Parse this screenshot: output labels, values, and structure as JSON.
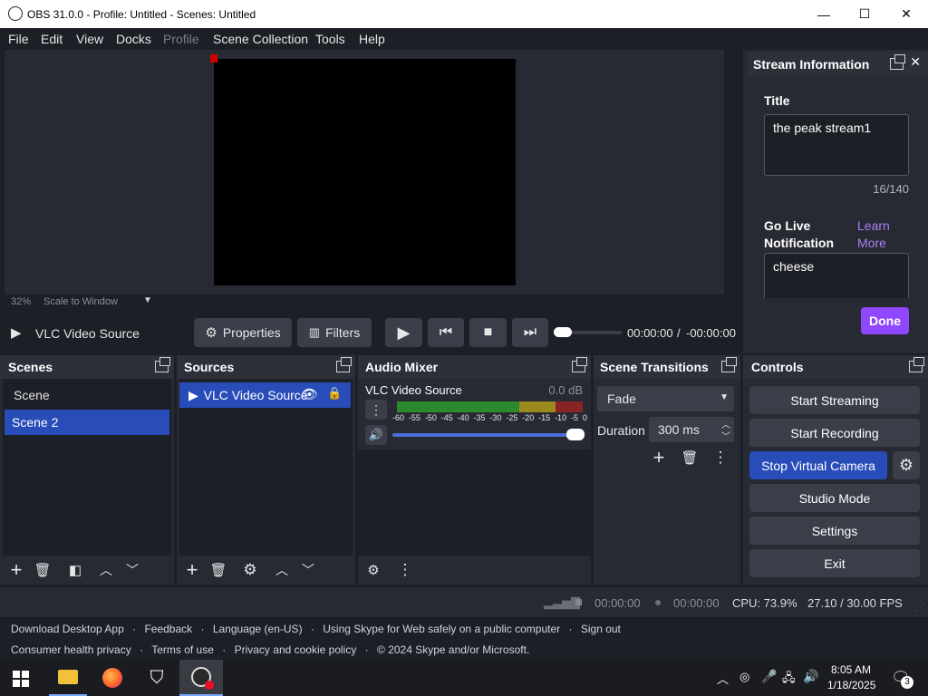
{
  "window": {
    "title": "OBS 31.0.0 - Profile: Untitled - Scenes: Untitled",
    "minimize": "—",
    "maximize": "☐",
    "close": "✕"
  },
  "menu": [
    "File",
    "Edit",
    "View",
    "Docks",
    "Profile",
    "Scene Collection",
    "Tools",
    "Help"
  ],
  "preview": {
    "zoom": "32%",
    "scale_mode": "Scale to Window"
  },
  "source_bar": {
    "source_name": "VLC Video Source",
    "properties_label": "Properties",
    "filters_label": "Filters",
    "time_current": "00:00:00",
    "time_separator": "/",
    "time_remaining": "-00:00:00",
    "progress": 0.0
  },
  "stream_info": {
    "header": "Stream Information",
    "title_label": "Title",
    "title_value": "the peak stream1",
    "title_count": "16/140",
    "go_live_label_1": "Go Live",
    "go_live_label_2": "Notification",
    "learn_more_1": "Learn",
    "learn_more_2": "More",
    "notification_value": "cheese",
    "done_label": "Done"
  },
  "scenes": {
    "header": "Scenes",
    "items": [
      {
        "label": "Scene",
        "selected": false
      },
      {
        "label": "Scene 2",
        "selected": true
      }
    ]
  },
  "sources": {
    "header": "Sources",
    "items": [
      {
        "label": "VLC Video Source",
        "visible": true,
        "locked": true
      }
    ]
  },
  "audio_mixer": {
    "header": "Audio Mixer",
    "channel_name": "VLC Video Source",
    "channel_db": "0.0 dB",
    "scale": [
      "-60",
      "-55",
      "-50",
      "-45",
      "-40",
      "-35",
      "-30",
      "-25",
      "-20",
      "-15",
      "-10",
      "-5",
      "0"
    ],
    "volume": 1.0
  },
  "transitions": {
    "header": "Scene Transitions",
    "selected": "Fade",
    "duration_label": "Duration",
    "duration_value": "300 ms"
  },
  "controls": {
    "header": "Controls",
    "start_streaming": "Start Streaming",
    "start_recording": "Start Recording",
    "stop_virtual_camera": "Stop Virtual Camera",
    "studio_mode": "Studio Mode",
    "settings": "Settings",
    "exit": "Exit"
  },
  "status": {
    "stream_time": "00:00:00",
    "record_time": "00:00:00",
    "cpu": "CPU: 73.9%",
    "fps": "27.10 / 30.00 FPS"
  },
  "footer": {
    "line1": [
      "Download Desktop App",
      "Feedback",
      "Language (en-US)",
      "Using Skype for Web safely on a public computer",
      "Sign out"
    ],
    "line2": [
      "Consumer health privacy",
      "Terms of use",
      "Privacy and cookie policy",
      "© 2024 Skype and/or Microsoft."
    ],
    "separator": "·"
  },
  "taskbar": {
    "time": "8:05 AM",
    "date": "1/18/2025",
    "notification_count": "3"
  },
  "colors": {
    "accent": "#284cb8",
    "done_button": "#9147ff",
    "learn_more": "#a97ff5",
    "dock_bg": "#272a33",
    "window_bg": "#1d1f26"
  }
}
